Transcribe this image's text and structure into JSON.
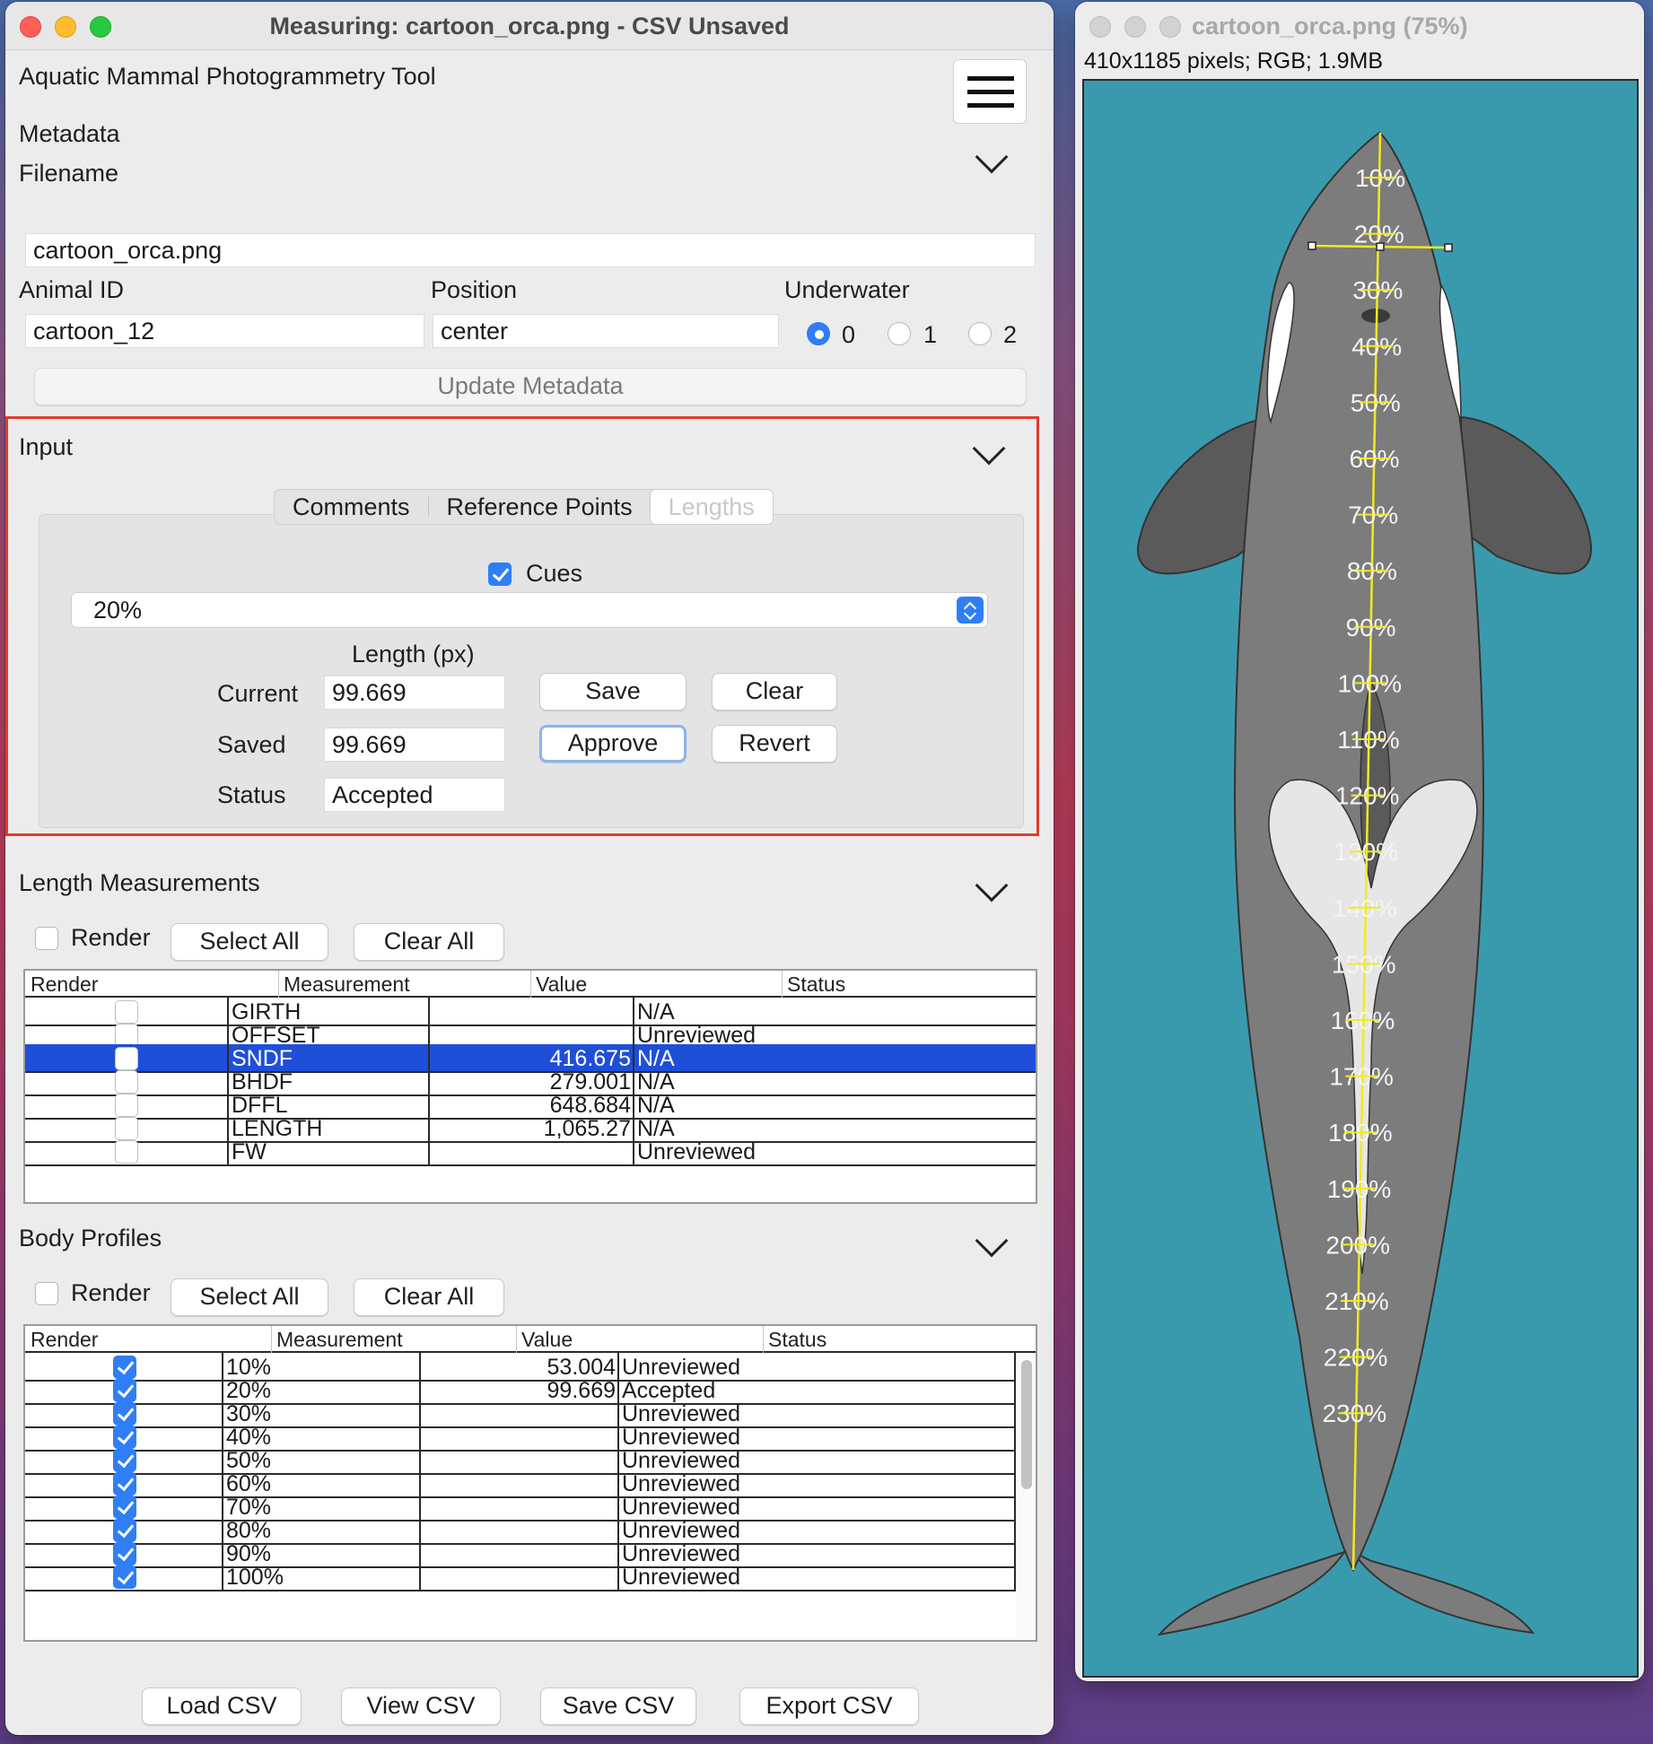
{
  "main_window": {
    "title": "Measuring: cartoon_orca.png  - CSV Unsaved",
    "app_title": "Aquatic Mammal Photogrammetry Tool"
  },
  "metadata": {
    "heading": "Metadata",
    "filename_label": "Filename",
    "filename": "cartoon_orca.png",
    "animal_id_label": "Animal ID",
    "animal_id": "cartoon_12",
    "position_label": "Position",
    "position": "center",
    "underwater_label": "Underwater",
    "underwater_options": [
      "0",
      "1",
      "2"
    ],
    "underwater_selected": "0",
    "update_button": "Update Metadata"
  },
  "input": {
    "heading": "Input",
    "tabs": [
      "Comments",
      "Reference Points",
      "Lengths"
    ],
    "selected_tab": "Lengths",
    "cues_label": "Cues",
    "cues_checked": true,
    "selected_measurement": "20%",
    "length_label": "Length (px)",
    "current_label": "Current",
    "current_value": "99.669",
    "saved_label": "Saved",
    "saved_value": "99.669",
    "status_label": "Status",
    "status_value": "Accepted",
    "save_button": "Save",
    "clear_button": "Clear",
    "approve_button": "Approve",
    "revert_button": "Revert"
  },
  "length_measurements": {
    "heading": "Length Measurements",
    "render_label": "Render",
    "select_all": "Select All",
    "clear_all": "Clear All",
    "columns": [
      "Render",
      "Measurement",
      "Value",
      "Status"
    ],
    "rows": [
      {
        "name": "GIRTH",
        "value": "",
        "status": "N/A",
        "render": false
      },
      {
        "name": "OFFSET",
        "value": "",
        "status": "Unreviewed",
        "render": false
      },
      {
        "name": "SNDF",
        "value": "416.675",
        "status": "N/A",
        "render": false,
        "selected": true
      },
      {
        "name": "BHDF",
        "value": "279.001",
        "status": "N/A",
        "render": false
      },
      {
        "name": "DFFL",
        "value": "648.684",
        "status": "N/A",
        "render": false
      },
      {
        "name": "LENGTH",
        "value": "1,065.27",
        "status": "N/A",
        "render": false
      },
      {
        "name": "FW",
        "value": "",
        "status": "Unreviewed",
        "render": false
      }
    ]
  },
  "body_profiles": {
    "heading": "Body Profiles",
    "render_label": "Render",
    "select_all": "Select All",
    "clear_all": "Clear All",
    "columns": [
      "Render",
      "Measurement",
      "Value",
      "Status"
    ],
    "rows": [
      {
        "name": "10%",
        "value": "53.004",
        "status": "Unreviewed",
        "render": true
      },
      {
        "name": "20%",
        "value": "99.669",
        "status": "Accepted",
        "render": true
      },
      {
        "name": "30%",
        "value": "",
        "status": "Unreviewed",
        "render": true
      },
      {
        "name": "40%",
        "value": "",
        "status": "Unreviewed",
        "render": true
      },
      {
        "name": "50%",
        "value": "",
        "status": "Unreviewed",
        "render": true
      },
      {
        "name": "60%",
        "value": "",
        "status": "Unreviewed",
        "render": true
      },
      {
        "name": "70%",
        "value": "",
        "status": "Unreviewed",
        "render": true
      },
      {
        "name": "80%",
        "value": "",
        "status": "Unreviewed",
        "render": true
      },
      {
        "name": "90%",
        "value": "",
        "status": "Unreviewed",
        "render": true
      },
      {
        "name": "100%",
        "value": "",
        "status": "Unreviewed",
        "render": true
      }
    ]
  },
  "footer_buttons": [
    "Load CSV",
    "View CSV",
    "Save CSV",
    "Export CSV"
  ],
  "image_window": {
    "title": "cartoon_orca.png (75%)",
    "info": "410x1185 pixels; RGB; 1.9MB",
    "percent_labels": [
      "10%",
      "20%",
      "30%",
      "40%",
      "50%",
      "60%",
      "70%",
      "80%",
      "90%",
      "100%",
      "110%",
      "120%",
      "130%",
      "140%",
      "150%",
      "160%",
      "170%",
      "180%",
      "190%",
      "200%",
      "210%",
      "220%",
      "230%"
    ],
    "colors": {
      "water": "#3a9aad",
      "body": "#7c7c7c",
      "dark_fin": "#5a5a5a",
      "patch": "#e6e6e6",
      "guide_line": "#f2ea1e"
    }
  }
}
